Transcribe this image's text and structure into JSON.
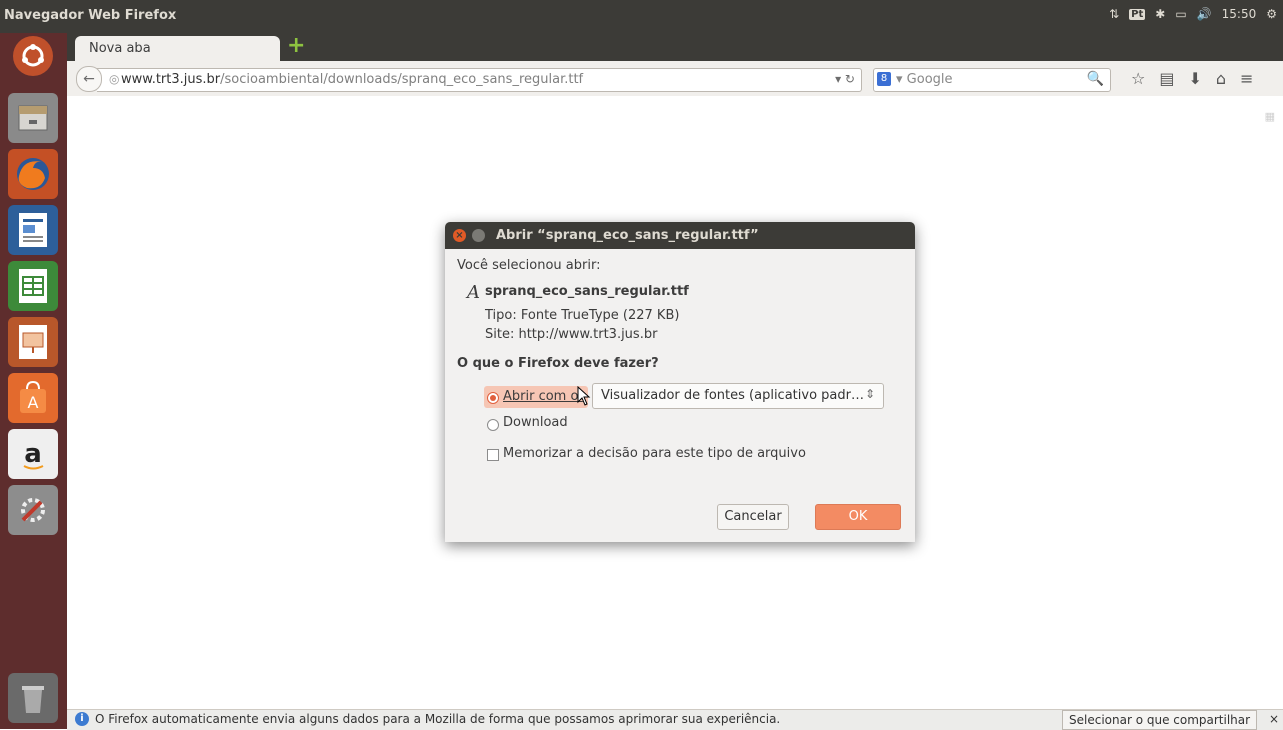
{
  "topbar": {
    "title": "Navegador Web Firefox",
    "keyboard_layout": "Pt",
    "time": "15:50"
  },
  "launcher": {
    "items": [
      "ubuntu-dash",
      "files",
      "firefox",
      "writer",
      "calc",
      "impress",
      "software-center",
      "amazon",
      "settings",
      "trash"
    ]
  },
  "browser": {
    "tab_label": "Nova aba",
    "url_domain": "www.trt3.jus.br",
    "url_path": "/socioambiental/downloads/spranq_eco_sans_regular.ttf",
    "search_placeholder": "Google",
    "notification": "O Firefox automaticamente envia alguns dados para a Mozilla de forma que possamos aprimorar sua experiência.",
    "share_button": "Selecionar o que compartilhar",
    "close_notification": "×"
  },
  "dialog": {
    "title": "Abrir “spranq_eco_sans_regular.ttf”",
    "intro": "Você selecionou abrir:",
    "file_name": "spranq_eco_sans_regular.ttf",
    "file_type": "Tipo: Fonte TrueType (227 KB)",
    "site": "Site: http://www.trt3.jus.br",
    "question": "O que o Firefox deve fazer?",
    "open_with_label": "Abrir com o:",
    "open_with_value": "Visualizador de fontes (aplicativo padr…",
    "download_label": "Download",
    "remember_label": "Memorizar a decisão para este tipo de arquivo",
    "cancel_label": "Cancelar",
    "ok_label": "OK"
  },
  "colors": {
    "accent": "#f38b63",
    "titlebar": "#3c3b37",
    "launcher": "#5e2d2d"
  }
}
